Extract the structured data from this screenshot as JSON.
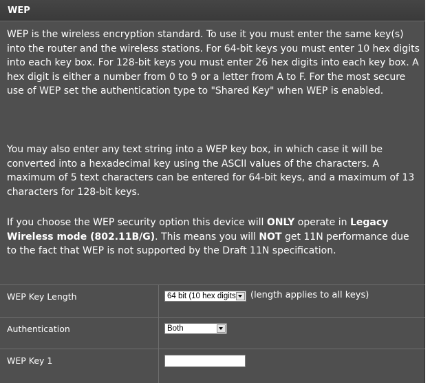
{
  "header": {
    "title": "WEP"
  },
  "description": {
    "p1": "WEP is the wireless encryption standard. To use it you must enter the same key(s) into the router and the wireless stations. For 64-bit keys you must enter 10 hex digits into each key box. For 128-bit keys you must enter 26 hex digits into each key box. A hex digit is either a number from 0 to 9 or a letter from A to F. For the most secure use of WEP set the authentication type to \"Shared Key\" when WEP is enabled.",
    "p2": "You may also enter any text string into a WEP key box, in which case it will be converted into a hexadecimal key using the ASCII values of the characters. A maximum of 5 text characters can be entered for 64-bit keys, and a maximum of 13 characters for 128-bit keys.",
    "p3": {
      "t1": "If you choose the WEP security option this device will ",
      "b1": "ONLY",
      "t2": " operate in ",
      "b2": "Legacy Wireless mode (802.11B/G)",
      "t3": ". This means you will ",
      "b3": "NOT",
      "t4": " get 11N performance due to the fact that WEP is not supported by the Draft 11N specification."
    }
  },
  "form": {
    "key_length": {
      "label": "WEP Key Length",
      "selected": "64 bit (10 hex digits)",
      "note": "(length applies to all keys)"
    },
    "authentication": {
      "label": "Authentication",
      "selected": "Both"
    },
    "key1": {
      "label": "WEP Key 1",
      "value": ""
    }
  },
  "colors": {
    "panel_bg": "#4f4f4f",
    "header_bg": "#3f3f3f",
    "text": "#ffffff",
    "divider": "#6e6e6e"
  }
}
